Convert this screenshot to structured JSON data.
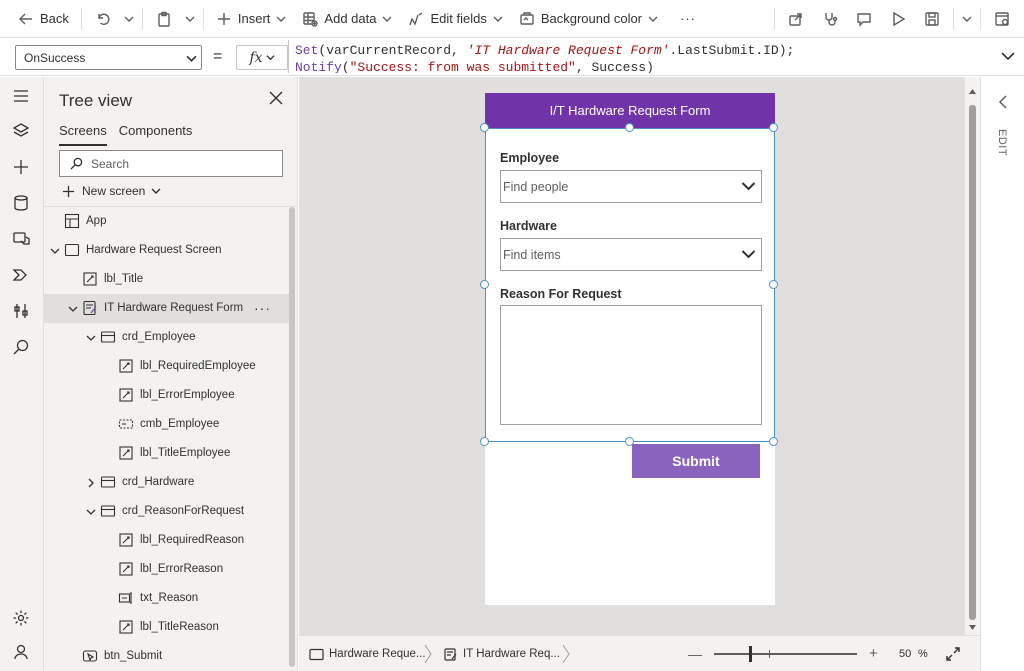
{
  "command_bar": {
    "back_label": "Back",
    "insert_label": "Insert",
    "add_data_label": "Add data",
    "edit_fields_label": "Edit fields",
    "background_color_label": "Background color",
    "more_label": "···"
  },
  "formula_bar": {
    "property": "OnSuccess",
    "equals": "=",
    "fx_label": "fx",
    "line1": {
      "fn": "Set",
      "part1": "(varCurrentRecord, ",
      "string": "'IT Hardware Request Form'",
      "part2": ".LastSubmit.ID);"
    },
    "line2": {
      "fn": "Notify",
      "part1": "(",
      "string": "\"Success: from was submitted\"",
      "part2": ", Success)"
    }
  },
  "tree_view": {
    "title": "Tree view",
    "tabs": [
      {
        "label": "Screens",
        "active": true
      },
      {
        "label": "Components",
        "active": false
      }
    ],
    "search_placeholder": "Search",
    "new_screen_label": "New screen",
    "nodes": [
      {
        "label": "App",
        "indent": 0,
        "icon": "app-icon",
        "toggle": "none"
      },
      {
        "label": "Hardware Request Screen",
        "indent": 0,
        "icon": "screen-icon",
        "toggle": "expanded"
      },
      {
        "label": "lbl_Title",
        "indent": 1,
        "icon": "label-icon",
        "toggle": "none"
      },
      {
        "label": "IT Hardware Request Form",
        "indent": 1,
        "icon": "form-icon",
        "toggle": "expanded",
        "selected": true,
        "more": "···"
      },
      {
        "label": "crd_Employee",
        "indent": 2,
        "icon": "card-icon",
        "toggle": "expanded"
      },
      {
        "label": "lbl_RequiredEmployee",
        "indent": 3,
        "icon": "label-icon",
        "toggle": "none"
      },
      {
        "label": "lbl_ErrorEmployee",
        "indent": 3,
        "icon": "label-icon",
        "toggle": "none"
      },
      {
        "label": "cmb_Employee",
        "indent": 3,
        "icon": "combobox-icon",
        "toggle": "none"
      },
      {
        "label": "lbl_TitleEmployee",
        "indent": 3,
        "icon": "label-icon",
        "toggle": "none"
      },
      {
        "label": "crd_Hardware",
        "indent": 2,
        "icon": "card-icon",
        "toggle": "collapsed"
      },
      {
        "label": "crd_ReasonForRequest",
        "indent": 2,
        "icon": "card-icon",
        "toggle": "expanded"
      },
      {
        "label": "lbl_RequiredReason",
        "indent": 3,
        "icon": "label-icon",
        "toggle": "none"
      },
      {
        "label": "lbl_ErrorReason",
        "indent": 3,
        "icon": "label-icon",
        "toggle": "none"
      },
      {
        "label": "txt_Reason",
        "indent": 3,
        "icon": "textinput-icon",
        "toggle": "none"
      },
      {
        "label": "lbl_TitleReason",
        "indent": 3,
        "icon": "label-icon",
        "toggle": "none"
      },
      {
        "label": "btn_Submit",
        "indent": 1,
        "icon": "button-icon",
        "toggle": "none"
      }
    ]
  },
  "canvas": {
    "form_title": "I/T Hardware Request Form",
    "employee_label": "Employee",
    "employee_placeholder": "Find people",
    "hardware_label": "Hardware",
    "hardware_placeholder": "Find items",
    "reason_label": "Reason For Request",
    "submit_label": "Submit"
  },
  "right_panel": {
    "edit_label": "EDIT"
  },
  "bottom_bar": {
    "tab1_label": "Hardware Reque...",
    "tab2_label": "IT Hardware Req...",
    "zoom_value": "50",
    "zoom_unit": "%",
    "zoom_minus": "—",
    "zoom_plus": "+"
  },
  "colors": {
    "form_header": "#7133a8",
    "submit_button": "#8a63bf",
    "selection": "#4e8fcf"
  }
}
